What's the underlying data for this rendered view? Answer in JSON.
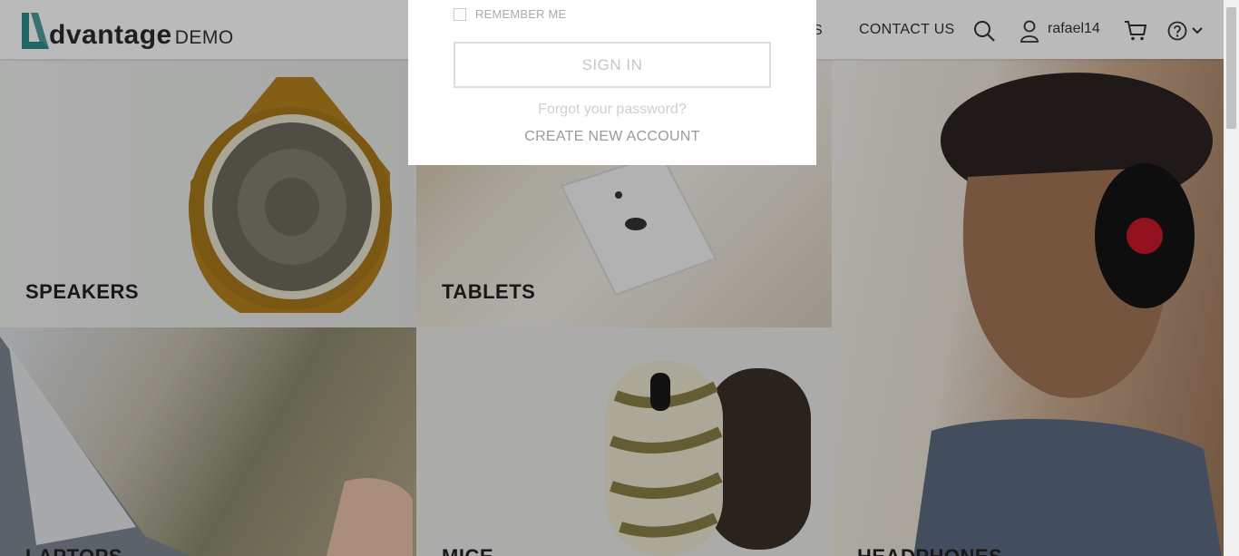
{
  "header": {
    "logo_word": "dvantage",
    "logo_demo": "DEMO",
    "nav_partial": "S",
    "nav_contact": "CONTACT US",
    "user_name": "rafael14",
    "icons": [
      "search-icon",
      "user-icon",
      "cart-icon",
      "help-icon",
      "chevron-down-icon"
    ]
  },
  "tiles": {
    "speakers": "SPEAKERS",
    "tablets": "TABLETS",
    "laptops": "LAPTOPS",
    "mice": "MICE",
    "headphones": "HEADPHONES"
  },
  "login_modal": {
    "remember_me": "REMEMBER ME",
    "sign_in": "SIGN IN",
    "forgot_password": "Forgot your password?",
    "create_account": "CREATE NEW ACCOUNT"
  },
  "colors": {
    "brand_teal": "#2e8c8a",
    "text_dark": "#333333",
    "overlay": "rgba(0,0,0,0.27)"
  }
}
